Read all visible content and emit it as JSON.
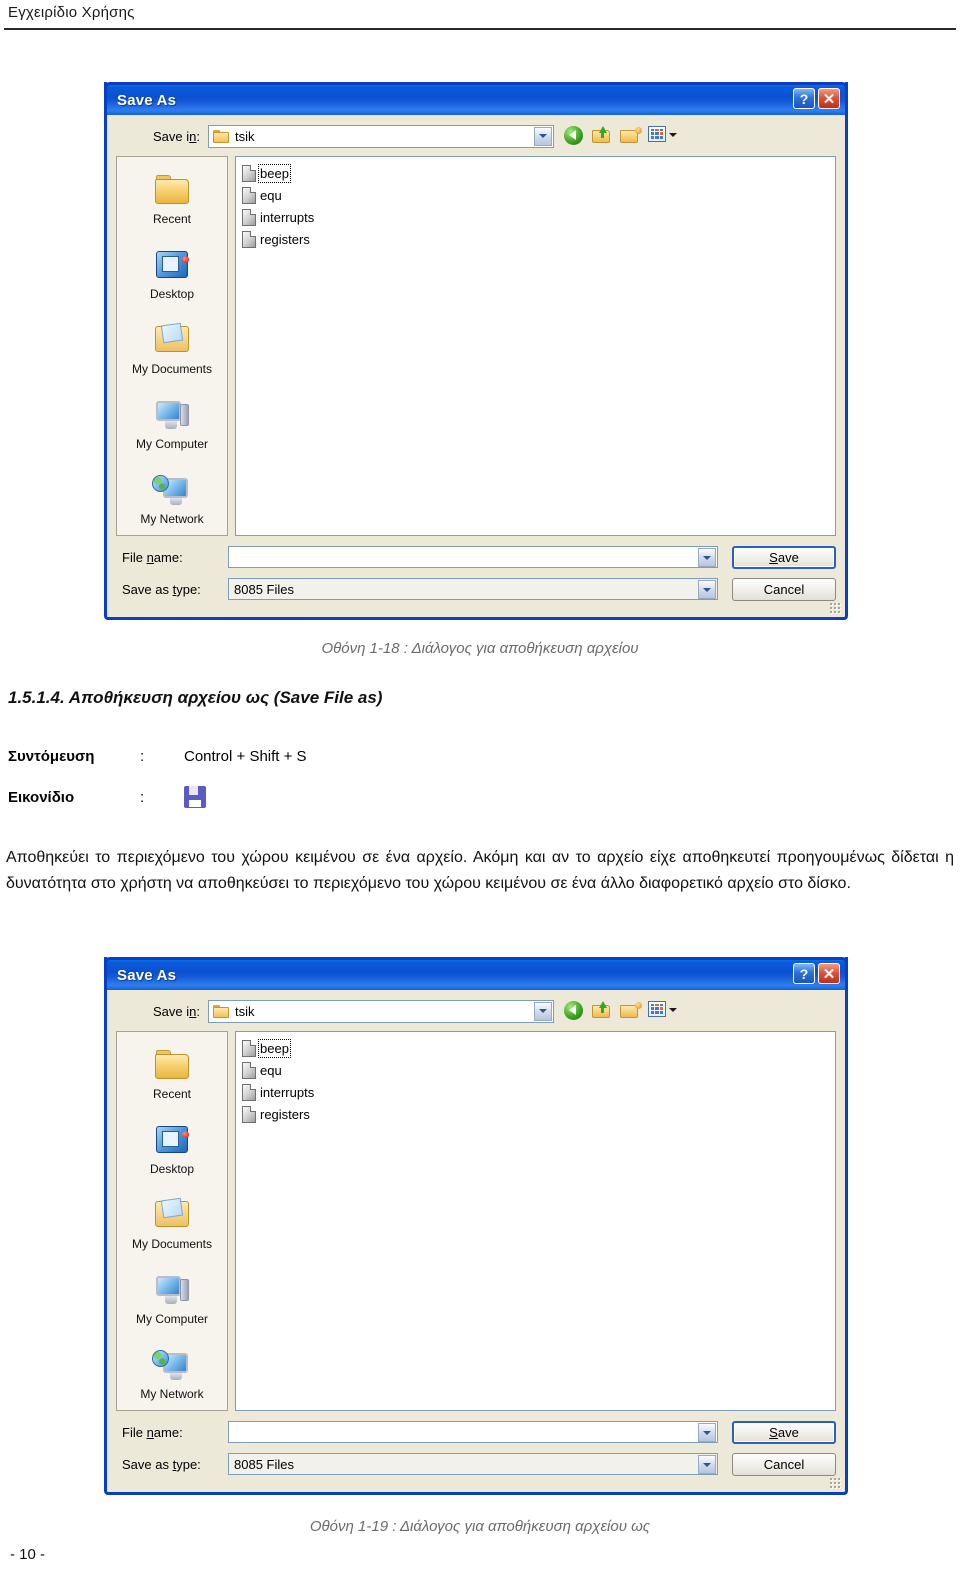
{
  "document": {
    "header_title": "Εγχειρίδιο Χρήσης",
    "page_number": "- 10 -",
    "section_heading": "1.5.1.4. Αποθήκευση αρχείου ως (Save File as)",
    "body_paragraph": "Αποθηκεύει το περιεχόμενο του χώρου κειμένου σε ένα αρχείο. Ακόμη και αν το αρχείο είχε αποθηκευτεί προηγουμένως δίδεται η δυνατότητα στο χρήστη να αποθηκεύσει το περιεχόμενο του χώρου κειμένου σε ένα άλλο διαφορετικό αρχείο στο δίσκο.",
    "caption_figure_1": "Οθόνη 1-18 : Διάλογος για αποθήκευση αρχείου",
    "caption_figure_2": "Οθόνη 1-19 : Διάλογος για αποθήκευση αρχείου ως"
  },
  "meta": {
    "shortcut_label": "Συντόμευση",
    "shortcut_colon": ":",
    "shortcut_value": "Control + Shift + S",
    "icon_label": "Εικονίδιο",
    "icon_colon": ":",
    "icon_name": "save-floppy-icon"
  },
  "dialog": {
    "title": "Save As",
    "help_button": "?",
    "close_button": "✕",
    "save_in_label": "Save in:",
    "save_in_value": "tsik",
    "toolbar": [
      {
        "name": "back-icon",
        "label": "Back"
      },
      {
        "name": "up-one-level-icon",
        "label": "Up One Level"
      },
      {
        "name": "create-new-folder-icon",
        "label": "Create New Folder"
      },
      {
        "name": "views-icon",
        "label": "Views"
      }
    ],
    "places": [
      {
        "label": "Recent",
        "icon": "recent-folder-icon"
      },
      {
        "label": "Desktop",
        "icon": "desktop-icon"
      },
      {
        "label": "My Documents",
        "icon": "my-documents-icon"
      },
      {
        "label": "My Computer",
        "icon": "my-computer-icon"
      },
      {
        "label": "My Network",
        "icon": "my-network-icon"
      }
    ],
    "files": [
      {
        "name": "beep",
        "focused": true
      },
      {
        "name": "equ",
        "focused": false
      },
      {
        "name": "interrupts",
        "focused": false
      },
      {
        "name": "registers",
        "focused": false
      }
    ],
    "file_name_label": "File name:",
    "file_name_value": "",
    "save_as_type_label": "Save as type:",
    "save_as_type_value": "8085 Files",
    "save_button": "Save",
    "cancel_button": "Cancel"
  },
  "colors": {
    "titlebar_blue": "#0a50d2",
    "dialog_face": "#ece9d8",
    "border_blue": "#0a3fc4",
    "close_red": "#c02d14",
    "caption_gray": "#6b6b6b",
    "save_icon_blue": "#5b5bc4"
  }
}
